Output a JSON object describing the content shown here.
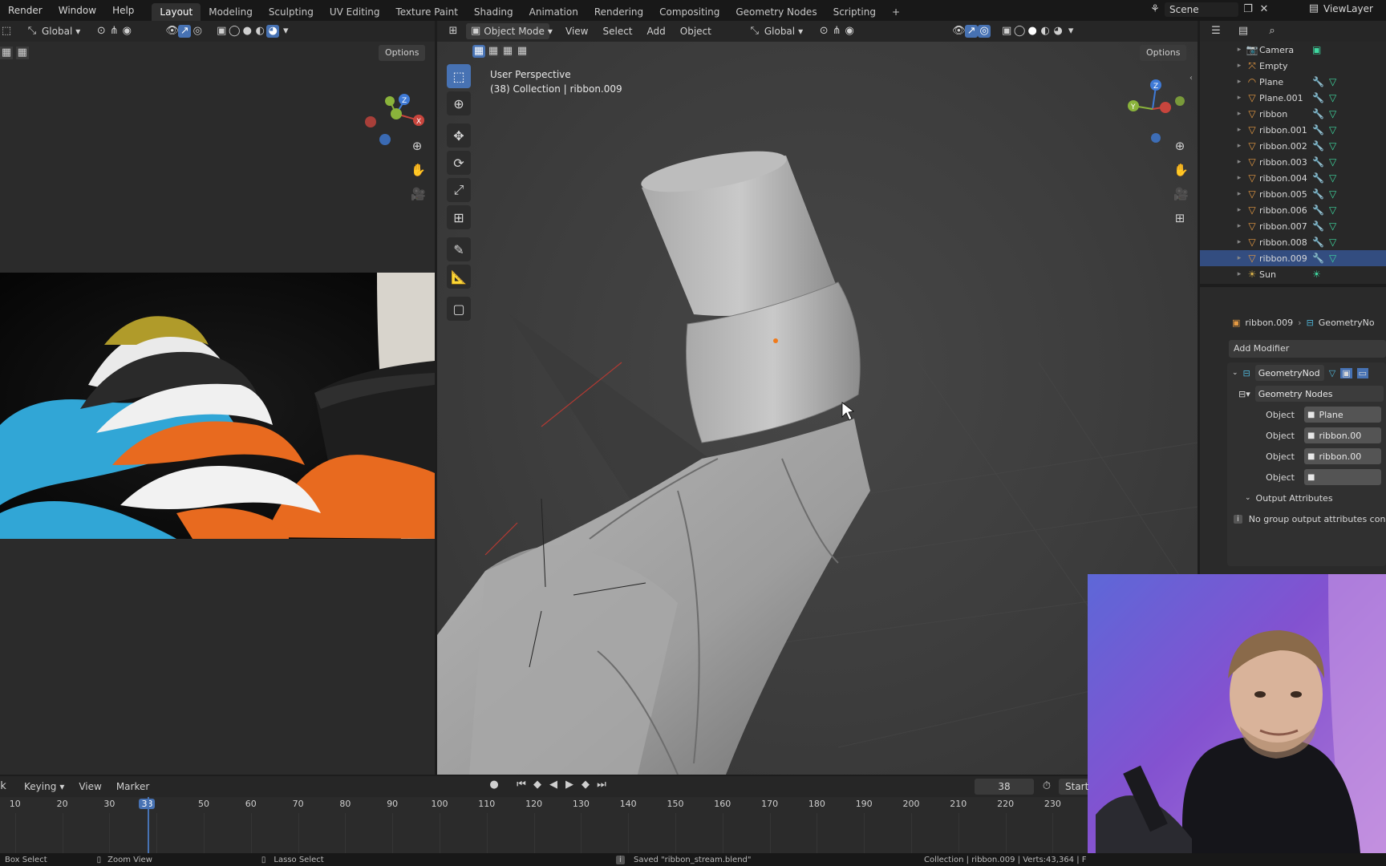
{
  "menu": {
    "items": [
      "Render",
      "Window",
      "Help"
    ],
    "workspaces": [
      "Layout",
      "Modeling",
      "Sculpting",
      "UV Editing",
      "Texture Paint",
      "Shading",
      "Animation",
      "Rendering",
      "Compositing",
      "Geometry Nodes",
      "Scripting"
    ],
    "active_workspace": "Layout",
    "add_tab": "+",
    "scene": "Scene",
    "view_layer": "ViewLayer"
  },
  "left_header": {
    "orientation": "Global",
    "options": "Options"
  },
  "main_header": {
    "mode": "Object Mode",
    "menus": [
      "View",
      "Select",
      "Add",
      "Object"
    ],
    "orientation": "Global",
    "options": "Options"
  },
  "viewport": {
    "title": "User Perspective",
    "subtitle": "(38) Collection | ribbon.009",
    "gizmo": {
      "x": "X",
      "y": "Y",
      "z": "Z"
    }
  },
  "outliner": {
    "items": [
      {
        "name": "Camera",
        "icon": "camera-icon"
      },
      {
        "name": "Empty",
        "icon": "empty-icon"
      },
      {
        "name": "Plane",
        "icon": "curve-icon"
      },
      {
        "name": "Plane.001",
        "icon": "mesh-icon"
      },
      {
        "name": "ribbon",
        "icon": "mesh-icon"
      },
      {
        "name": "ribbon.001",
        "icon": "mesh-icon"
      },
      {
        "name": "ribbon.002",
        "icon": "mesh-icon"
      },
      {
        "name": "ribbon.003",
        "icon": "mesh-icon"
      },
      {
        "name": "ribbon.004",
        "icon": "mesh-icon"
      },
      {
        "name": "ribbon.005",
        "icon": "mesh-icon"
      },
      {
        "name": "ribbon.006",
        "icon": "mesh-icon"
      },
      {
        "name": "ribbon.007",
        "icon": "mesh-icon"
      },
      {
        "name": "ribbon.008",
        "icon": "mesh-icon"
      },
      {
        "name": "ribbon.009",
        "icon": "mesh-icon"
      },
      {
        "name": "Sun",
        "icon": "light-icon"
      }
    ],
    "selected": "ribbon.009"
  },
  "properties": {
    "breadcrumb_object": "ribbon.009",
    "breadcrumb_modifier": "GeometryNo",
    "add_modifier": "Add Modifier",
    "modifier_name": "GeometryNod",
    "node_group": "Geometry Nodes",
    "inputs": [
      {
        "label": "Object",
        "value": "Plane"
      },
      {
        "label": "Object",
        "value": "ribbon.00"
      },
      {
        "label": "Object",
        "value": "ribbon.00"
      },
      {
        "label": "Object",
        "value": ""
      }
    ],
    "output_attributes": "Output Attributes",
    "info": "No group output attributes conne"
  },
  "timeline": {
    "menus": [
      "Keying",
      "View",
      "Marker"
    ],
    "current_frame": "38",
    "start_label": "Start",
    "ticks": [
      "10",
      "20",
      "30",
      "38",
      "50",
      "60",
      "70",
      "80",
      "90",
      "100",
      "110",
      "120",
      "130",
      "140",
      "150",
      "160",
      "170",
      "180",
      "190",
      "200",
      "210",
      "220",
      "230"
    ]
  },
  "status": {
    "left1": "Box Select",
    "left2": "Zoom View",
    "left3": "Lasso Select",
    "message": "Saved \"ribbon_stream.blend\"",
    "right": "Collection | ribbon.009 | Verts:43,364 | F"
  },
  "colors": {
    "accent": "#4772b3",
    "x_axis": "#c8453d",
    "y_axis": "#8ab33b",
    "z_axis": "#3f7ad6",
    "mesh_icon": "#e69a43",
    "modifier_icon": "#4fb5d8"
  }
}
